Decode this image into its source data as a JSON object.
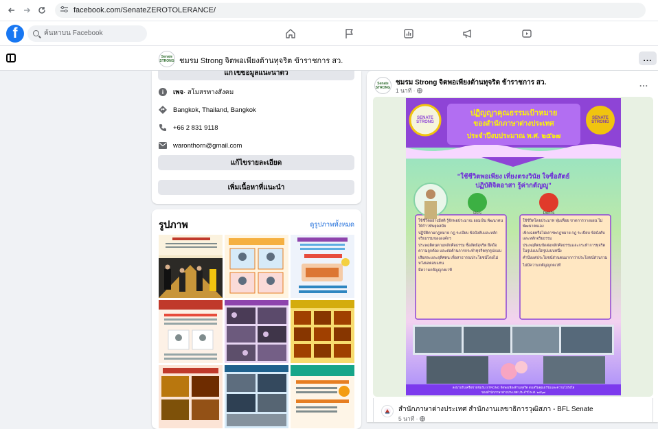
{
  "browser": {
    "url": "facebook.com/SenateZEROTOLERANCE/",
    "back_icon": "arrow-left-icon",
    "forward_icon": "arrow-right-icon",
    "reload_icon": "reload-icon"
  },
  "fb_nav": {
    "search_placeholder": "ค้นหาบน Facebook",
    "icons": [
      "home-icon",
      "pages-flag-icon",
      "dashboard-icon",
      "ad-center-icon",
      "video-icon"
    ]
  },
  "page_header": {
    "title": "ชมรม Strong จิตพอเพียงต้านทุจริต ข้าราชการ สว.",
    "avatar_text": "Senate STRONG",
    "more": "..."
  },
  "intro": {
    "partial_button": "แก้ไขข้อมูลแนะนำตัว",
    "category_prefix": "เพจ",
    "category": " · สโมสรทางสังคม",
    "location": "Bangkok, Thailand, Bangkok",
    "phone": "+66 2 831 9118",
    "email": "waronthorn@gmail.com",
    "edit_details": "แก้ไขรายละเอียด",
    "add_featured": "เพิ่มเนื้อหาที่แนะนำ"
  },
  "photos": {
    "title": "รูปภาพ",
    "see_all": "ดูรูปภาพทั้งหมด"
  },
  "post": {
    "author": "ชมรม Strong จิตพอเพียงต้านทุจริต ข้าราชการ สว.",
    "time": "1 นาที · ",
    "more": "...",
    "poster": {
      "title_lines": [
        "ปฏิญญาคุณธรรมเป้าหมาย",
        "ของสำนักภาษาต่างประเทศ",
        "ประจำปีงบประมาณ พ.ศ. ๒๕๖๗"
      ],
      "logo_left": "SENATE STRONG",
      "logo_right": "SENATE STRONG",
      "slogan_lines": [
        "\"ใช้ชีวิตพอเพียง เที่ยงตรงวินัย ใจซื่อสัตย์",
        "ปฏิบัติจิตอาสา รู้ค่ากตัญญู\""
      ],
      "dos_label": "Do's",
      "donts_label": "Don'ts",
      "dos": [
        "ใช้ชีวิตอย่างมีสติ รู้จักพอประมาณ ออมเงิน พัฒนาตนให้ก้าวทันยุคสมัย",
        "ปฏิบัติตามกฎหมาย กฎ ระเบียบ ข้อบังคับและหลักจริยธรรมขององค์กร",
        "ประพฤติตนตามหลักศีลธรรม ซื่อสัตย์สุจริต ยึดถือความถูกต้อง และต่อต้านการกระทำทุจริตทุกรูปแบบ",
        "เสียสละและอุทิศตน เพื่อสาธารณประโยชน์โดยไม่หวังผลตอบแทน",
        "มีความกตัญญูกตเวที"
      ],
      "donts": [
        "ใช้ชีวิตโดยประมาท ฟุ่มเฟือย ขาดการวางแผน ไม่พัฒนาตนเอง",
        "เพิกเฉยหรือไม่เคารพกฎหมาย กฎ ระเบียบ ข้อบังคับและหลักจริยธรรม",
        "ประพฤติตนขัดต่อหลักศีลธรรมและกระทำการทุจริตในรูปแบบใดรูปแบบหนึ่ง",
        "คำนึงแต่ประโยชน์ส่วนตนมากกว่าประโยชน์ส่วนรวม",
        "ไม่มีความกตัญญูกตเวที"
      ],
      "footer_lines": [
        "ลงนามรับเครือข่ายชมรม STRONG จิตพอเพียงต้านทุจริต ส่งเสริมคุณธรรมและความโปร่งใส",
        "ของสำนักภาษาต่างประเทศ ประจำปี พ.ศ. ๒๕๖๗"
      ]
    }
  },
  "shared": {
    "name": "สำนักภาษาต่างประเทศ สำนักงานเลขาธิการวุฒิสภา - BFL Senate",
    "time": "5 นาที · "
  },
  "colors": {
    "fb_blue": "#1877f2",
    "link_blue": "#216fdb",
    "poster_purple": "#8e44d6",
    "poster_teal": "#66d4c8",
    "dos_green": "#3cb043",
    "donts_red": "#e03a2b"
  }
}
